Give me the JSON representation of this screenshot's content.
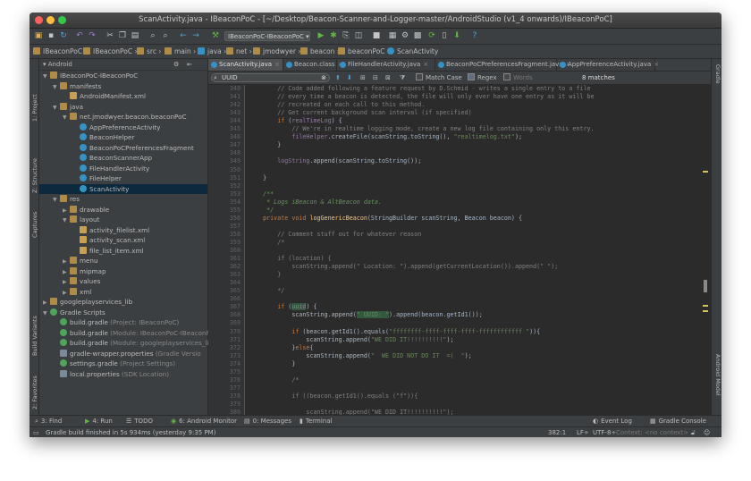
{
  "window": {
    "title": "ScanActivity.java - IBeaconPoC - [~/Desktop/Beacon-Scanner-and-Logger-master/AndroidStudio (v1_4 onwards)/IBeaconPoC]"
  },
  "toolbar": {
    "run_config": "IBeaconPoC-IBeaconPoC"
  },
  "breadcrumbs": [
    "IBeaconPoC",
    "IBeaconPoC",
    "src",
    "main",
    "java",
    "net",
    "jmodwyer",
    "beacon",
    "beaconPoC",
    "ScanActivity"
  ],
  "left_strip": {
    "project": "1: Project",
    "structure": "Z: Structure",
    "captures": "Captures",
    "build_variants": "Build Variants",
    "favorites": "2: Favorites"
  },
  "right_strip": {
    "gradle": "Gradle",
    "android_model": "Android Model"
  },
  "project_panel": {
    "view": "Android",
    "items": [
      {
        "label": "IBeaconPoC-IBeaconPoC",
        "extra": "",
        "icon": "folder-icon",
        "arrow": "▼",
        "indent": 0
      },
      {
        "label": "manifests",
        "extra": "",
        "icon": "folder-icon",
        "arrow": "▼",
        "indent": 1
      },
      {
        "label": "AndroidManifest.xml",
        "extra": "",
        "icon": "xml-icon",
        "arrow": "",
        "indent": 2
      },
      {
        "label": "java",
        "extra": "",
        "icon": "folder-icon",
        "arrow": "▼",
        "indent": 1
      },
      {
        "label": "net.jmodwyer.beacon.beaconPoC",
        "extra": "",
        "icon": "folder-icon",
        "arrow": "▼",
        "indent": 2
      },
      {
        "label": "AppPreferenceActivity",
        "extra": "",
        "icon": "class-icon",
        "arrow": "",
        "indent": 3
      },
      {
        "label": "BeaconHelper",
        "extra": "",
        "icon": "class-icon",
        "arrow": "",
        "indent": 3
      },
      {
        "label": "BeaconPoCPreferencesFragment",
        "extra": "",
        "icon": "class-icon",
        "arrow": "",
        "indent": 3
      },
      {
        "label": "BeaconScannerApp",
        "extra": "",
        "icon": "class-icon",
        "arrow": "",
        "indent": 3
      },
      {
        "label": "FileHandlerActivity",
        "extra": "",
        "icon": "class-icon",
        "arrow": "",
        "indent": 3
      },
      {
        "label": "FileHelper",
        "extra": "",
        "icon": "class-icon",
        "arrow": "",
        "indent": 3
      },
      {
        "label": "ScanActivity",
        "extra": "",
        "icon": "class-icon",
        "arrow": "",
        "indent": 3,
        "selected": true
      },
      {
        "label": "res",
        "extra": "",
        "icon": "folder-icon",
        "arrow": "▼",
        "indent": 1
      },
      {
        "label": "drawable",
        "extra": "",
        "icon": "folder-icon",
        "arrow": "▶",
        "indent": 2
      },
      {
        "label": "layout",
        "extra": "",
        "icon": "folder-icon",
        "arrow": "▼",
        "indent": 2
      },
      {
        "label": "activity_filelist.xml",
        "extra": "",
        "icon": "xml-icon",
        "arrow": "",
        "indent": 3
      },
      {
        "label": "activity_scan.xml",
        "extra": "",
        "icon": "xml-icon",
        "arrow": "",
        "indent": 3
      },
      {
        "label": "file_list_item.xml",
        "extra": "",
        "icon": "xml-icon",
        "arrow": "",
        "indent": 3
      },
      {
        "label": "menu",
        "extra": "",
        "icon": "folder-icon",
        "arrow": "▶",
        "indent": 2
      },
      {
        "label": "mipmap",
        "extra": "",
        "icon": "folder-icon",
        "arrow": "▶",
        "indent": 2
      },
      {
        "label": "values",
        "extra": "",
        "icon": "folder-icon",
        "arrow": "▶",
        "indent": 2
      },
      {
        "label": "xml",
        "extra": "",
        "icon": "folder-icon",
        "arrow": "▶",
        "indent": 2
      },
      {
        "label": "googleplayservices_lib",
        "extra": "",
        "icon": "folder-icon",
        "arrow": "▶",
        "indent": 0
      },
      {
        "label": "Gradle Scripts",
        "extra": "",
        "icon": "gradle-icon",
        "arrow": "▼",
        "indent": 0
      },
      {
        "label": "build.gradle",
        "extra": " (Project: IBeaconPoC)",
        "icon": "gradle-icon",
        "arrow": "",
        "indent": 1
      },
      {
        "label": "build.gradle",
        "extra": " (Module: IBeaconPoC-IBeaconPo",
        "icon": "gradle-icon",
        "arrow": "",
        "indent": 1
      },
      {
        "label": "build.gradle",
        "extra": " (Module: googleplayservices_li",
        "icon": "gradle-icon",
        "arrow": "",
        "indent": 1
      },
      {
        "label": "gradle-wrapper.properties",
        "extra": " (Gradle Versio",
        "icon": "prop-icon",
        "arrow": "",
        "indent": 1
      },
      {
        "label": "settings.gradle",
        "extra": " (Project Settings)",
        "icon": "gradle-icon",
        "arrow": "",
        "indent": 1
      },
      {
        "label": "local.properties",
        "extra": " (SDK Location)",
        "icon": "prop-icon",
        "arrow": "",
        "indent": 1
      }
    ]
  },
  "editor_tabs": [
    {
      "label": "ScanActivity.java",
      "active": true
    },
    {
      "label": "Beacon.class",
      "active": false
    },
    {
      "label": "FileHandlerActivity.java",
      "active": false
    },
    {
      "label": "BeaconPoCPreferencesFragment.java",
      "active": false
    },
    {
      "label": "AppPreferenceActivity.java",
      "active": false
    }
  ],
  "find": {
    "query": "UUID",
    "match_case": "Match Case",
    "regex": "Regex",
    "words": "Words",
    "matches": "8 matches"
  },
  "code": {
    "first_line": 340,
    "lines": [
      [
        [
          "cm",
          "        // Code added following a feature request by D.Schmid - writes a single entry to a file"
        ]
      ],
      [
        [
          "cm",
          "        // every time a beacon is detected, the file will only ever have one entry as it will be"
        ]
      ],
      [
        [
          "cm",
          "        // recreated on each call to this method."
        ]
      ],
      [
        [
          "cm",
          "        // Get current background scan interval (if specified)"
        ]
      ],
      [
        [
          "",
          "        "
        ],
        [
          "kw",
          "if"
        ],
        [
          "",
          " ("
        ],
        [
          "fd",
          "realTimeLog"
        ],
        [
          "",
          ") {"
        ]
      ],
      [
        [
          "cm",
          "            // We're in realtime logging mode, create a new log file containing only this entry."
        ]
      ],
      [
        [
          "fd",
          "            fileHelper"
        ],
        [
          "",
          ".createFile(scanString.toString(), "
        ],
        [
          "st",
          "\"realtimelog.txt\""
        ],
        [
          "",
          ");"
        ]
      ],
      [
        [
          "",
          "        }"
        ]
      ],
      [
        [
          "",
          ""
        ]
      ],
      [
        [
          "fd",
          "        logString"
        ],
        [
          "",
          ".append(scanString.toString());"
        ]
      ],
      [
        [
          "",
          ""
        ]
      ],
      [
        [
          "",
          "    }"
        ]
      ],
      [
        [
          "",
          ""
        ]
      ],
      [
        [
          "jd",
          "    /**"
        ]
      ],
      [
        [
          "jd",
          "     * Logs iBeacon & AltBeacon data."
        ]
      ],
      [
        [
          "jd",
          "     */"
        ]
      ],
      [
        [
          "kw",
          "    private void "
        ],
        [
          "fn",
          "logGenericBeacon"
        ],
        [
          "",
          "(StringBuilder scanString, Beacon beacon) {"
        ]
      ],
      [
        [
          "",
          ""
        ]
      ],
      [
        [
          "cm",
          "        // Comment stuff out for whatever reason"
        ]
      ],
      [
        [
          "cm",
          "        /*"
        ]
      ],
      [
        [
          "",
          ""
        ]
      ],
      [
        [
          "cm",
          "        if (location) {"
        ]
      ],
      [
        [
          "cm",
          "            scanString.append(\" Location: \").append(getCurrentLocation()).append(\" \");"
        ]
      ],
      [
        [
          "cm",
          "        }"
        ]
      ],
      [
        [
          "",
          ""
        ]
      ],
      [
        [
          "cm",
          "        */"
        ]
      ],
      [
        [
          "",
          ""
        ]
      ],
      [
        [
          "",
          "        "
        ],
        [
          "kw",
          "if"
        ],
        [
          "",
          " ("
        ],
        [
          "fd",
          "uuid"
        ],
        [
          "",
          ") {"
        ]
      ],
      [
        [
          "",
          "            scanString.append("
        ],
        [
          "st",
          "\" UUID: \""
        ],
        [
          "",
          ").append(beacon.getId1());"
        ]
      ],
      [
        [
          "",
          ""
        ]
      ],
      [
        [
          "",
          "            "
        ],
        [
          "kw",
          "if"
        ],
        [
          "",
          " (beacon.getId1()."
        ],
        [
          "",
          "equals"
        ],
        [
          "",
          "("
        ],
        [
          "st",
          "\"ffffffff-ffff-ffff-ffff-ffffffffffff \""
        ],
        [
          "",
          ")){"
        ]
      ],
      [
        [
          "",
          "                scanString.append("
        ],
        [
          "st",
          "\"WE DID IT!!!!!!!!!!\""
        ],
        [
          "",
          ");"
        ]
      ],
      [
        [
          "",
          "            }"
        ],
        [
          "kw",
          "else"
        ],
        [
          "",
          "{"
        ]
      ],
      [
        [
          "",
          "                scanString.append("
        ],
        [
          "st",
          "\"  WE DID NOT DO IT  =(  \""
        ],
        [
          "",
          ");"
        ]
      ],
      [
        [
          "",
          "            }"
        ]
      ],
      [
        [
          "",
          ""
        ]
      ],
      [
        [
          "cm",
          "            /*"
        ]
      ],
      [
        [
          "",
          ""
        ]
      ],
      [
        [
          "cm",
          "            if ((beacon.getId1().equals (\"f\")){"
        ]
      ],
      [
        [
          "",
          ""
        ]
      ],
      [
        [
          "cm",
          "                scanString.append(\"WE DID IT!!!!!!!!!!\");"
        ]
      ]
    ]
  },
  "tool_windows": [
    {
      "label": "3: Find",
      "icon": "search-icon"
    },
    {
      "label": "4: Run",
      "icon": "run-icon"
    },
    {
      "label": "TODO",
      "icon": "todo-icon"
    },
    {
      "label": "6: Android Monitor",
      "icon": "android-icon"
    },
    {
      "label": "0: Messages",
      "icon": "messages-icon"
    },
    {
      "label": "Terminal",
      "icon": "terminal-icon"
    },
    {
      "label": "Event Log",
      "icon": "event-log-icon"
    },
    {
      "label": "Gradle Console",
      "icon": "gradle-console-icon"
    }
  ],
  "status": {
    "message": "Gradle build finished in 5s 934ms (yesterday 9:35 PM)",
    "position": "382:1",
    "line_sep": "LF÷",
    "encoding": "UTF-8÷",
    "context": "Context: <no context>"
  },
  "colors": {
    "accent": "#3592c4",
    "editor_bg": "#2b2b2b",
    "panel_bg": "#3c3f41",
    "selection": "#0d293e"
  }
}
